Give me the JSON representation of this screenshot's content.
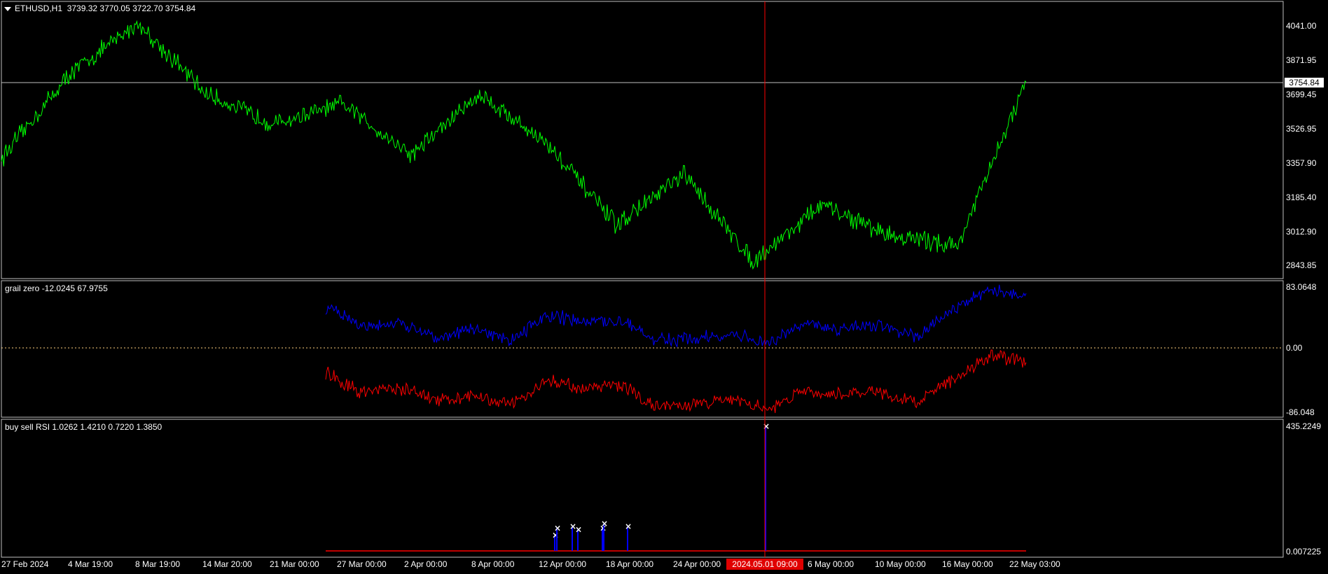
{
  "main": {
    "symbol": "ETHUSD,H1",
    "ohlc": "3739.32 3770.05 3722.70 3754.84",
    "current_price": "3754.84",
    "price_axis": [
      "4041.00",
      "3871.95",
      "3699.45",
      "3526.95",
      "3357.90",
      "3185.40",
      "3012.90",
      "2843.85"
    ]
  },
  "indicator1": {
    "title": "grail zero -12.0245 67.9755",
    "axis": [
      "83.0648",
      "0.00",
      "-86.048"
    ]
  },
  "indicator2": {
    "title": "buy sell RSI 1.0262 1.4210 0.7220 1.3850",
    "axis_top": "435.2249",
    "axis_bottom": "0.007225"
  },
  "time_axis": [
    "27 Feb 2024",
    "4 Mar 19:00",
    "8 Mar 19:00",
    "14 Mar 20:00",
    "21 Mar 00:00",
    "27 Mar 00:00",
    "2 Apr 00:00",
    "8 Apr 00:00",
    "12 Apr 00:00",
    "18 Apr 00:00",
    "24 Apr 00:00",
    "6 May 00:00",
    "10 May 00:00",
    "16 May 00:00",
    "22 May 03:00"
  ],
  "crosshair_time": "2024.05.01 09:00",
  "colors": {
    "price_line": "#00ff00",
    "blue_line": "#0000ff",
    "red_line": "#ff0000",
    "crosshair": "#ff0000",
    "marker": "#ffffff",
    "background": "#000000",
    "grid_frame": "#c0c0c0"
  },
  "chart_data": [
    {
      "type": "line",
      "title": "ETHUSD,H1",
      "x": [
        "27 Feb 2024",
        "4 Mar 19:00",
        "8 Mar 19:00",
        "14 Mar 20:00",
        "21 Mar 00:00",
        "27 Mar 00:00",
        "2 Apr 00:00",
        "8 Apr 00:00",
        "12 Apr 00:00",
        "18 Apr 00:00",
        "24 Apr 00:00",
        "2024.05.01 09:00",
        "6 May 00:00",
        "10 May 00:00",
        "16 May 00:00",
        "22 May 03:00"
      ],
      "series": [
        {
          "name": "ETHUSD,H1",
          "values": [
            3380,
            3800,
            4050,
            3700,
            3550,
            3650,
            3400,
            3700,
            3450,
            3050,
            3300,
            2870,
            3150,
            3000,
            2950,
            3754.84
          ]
        }
      ],
      "ylim": [
        2843.85,
        4041.0
      ]
    },
    {
      "type": "line",
      "title": "grail zero",
      "series": [
        {
          "name": "blue",
          "values": [
            55,
            30,
            35,
            15,
            25,
            10,
            45,
            35,
            40,
            10,
            12,
            20,
            5,
            35,
            25,
            30,
            15,
            50,
            80,
            70
          ]
        },
        {
          "name": "red",
          "values": [
            -35,
            -60,
            -55,
            -70,
            -65,
            -80,
            -45,
            -55,
            -50,
            -80,
            -78,
            -70,
            -85,
            -55,
            -65,
            -60,
            -75,
            -45,
            -10,
            -20
          ]
        }
      ],
      "ylim": [
        -86.048,
        83.0648
      ]
    },
    {
      "type": "bar",
      "title": "buy sell RSI",
      "categories": [
        "12 Apr 00:00",
        "12 Apr 00:00",
        "13 Apr",
        "13 Apr",
        "16 Apr",
        "16 Apr",
        "17 Apr",
        "2024.05.01 09:00"
      ],
      "values": [
        55,
        80,
        85,
        75,
        80,
        95,
        85,
        435.2249
      ],
      "ylim": [
        0.007225,
        435.2249
      ]
    }
  ]
}
